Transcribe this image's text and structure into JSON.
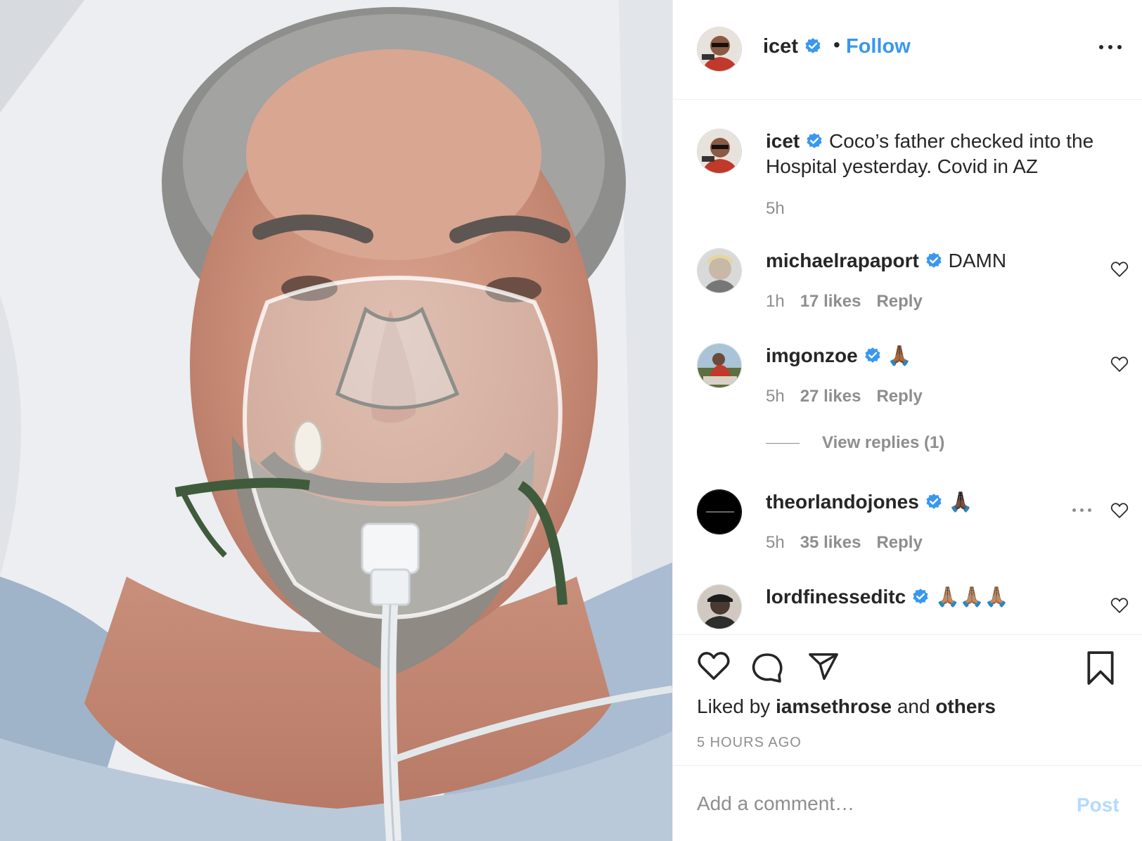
{
  "post": {
    "username": "icet",
    "follow_label": "Follow",
    "separator": "•",
    "caption": "Coco’s father checked into the Hospital yesterday. Covid in AZ",
    "caption_time": "5h"
  },
  "comments": [
    {
      "username": "michaelrapaport",
      "text": "DAMN",
      "time": "1h",
      "likes": "17 likes",
      "reply": "Reply",
      "verified": true
    },
    {
      "username": "imgonzoe",
      "text": "🙏🏾",
      "time": "5h",
      "likes": "27 likes",
      "reply": "Reply",
      "verified": true,
      "view_replies": "View replies (1)"
    },
    {
      "username": "theorlandojones",
      "text": "🙏🏿",
      "time": "5h",
      "likes": "35 likes",
      "reply": "Reply",
      "verified": true
    },
    {
      "username": "lordfinesseditc",
      "text": "🙏🏽🙏🏽🙏🏽",
      "verified": true
    }
  ],
  "actions": {
    "liked_prefix": "Liked by",
    "liked_user": "iamsethrose",
    "liked_and": "and",
    "liked_others": "others",
    "time_ago": "5 HOURS AGO"
  },
  "comment_box": {
    "placeholder": "Add a comment…",
    "post_label": "Post"
  },
  "colors": {
    "link": "#3897f0",
    "verified": "#3897f0",
    "text": "#262626",
    "muted": "#8e8e8e",
    "post_disabled": "#b3dbff"
  },
  "icons": [
    "verified-badge-icon",
    "more-options-icon",
    "heart-icon",
    "comment-icon",
    "share-icon",
    "bookmark-icon"
  ]
}
